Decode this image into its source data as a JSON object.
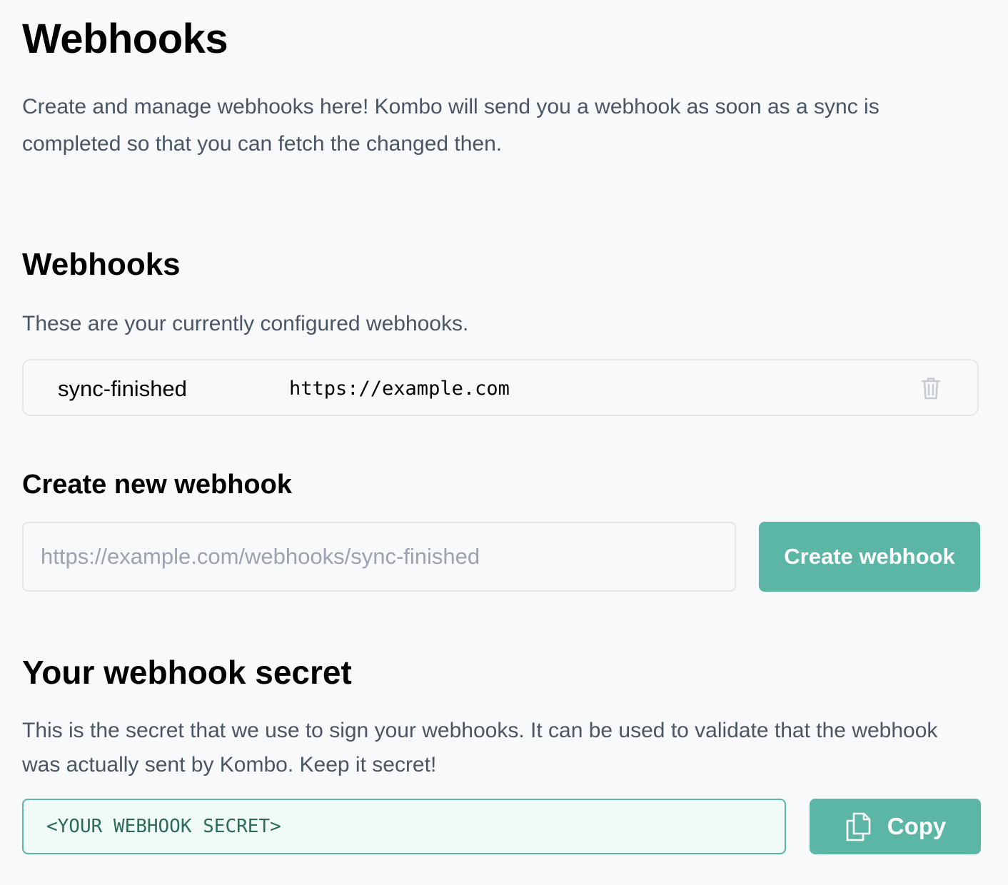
{
  "page": {
    "title": "Webhooks",
    "intro": "Create and manage webhooks here! Kombo will send you a webhook as soon as a sync is completed so that you can fetch the changed then."
  },
  "webhooks_section": {
    "title": "Webhooks",
    "description": "These are your currently configured webhooks.",
    "items": [
      {
        "event": "sync-finished",
        "url": "https://example.com",
        "delete_icon": "trash-icon"
      }
    ]
  },
  "create_section": {
    "title": "Create new webhook",
    "input_value": "",
    "input_placeholder": "https://example.com/webhooks/sync-finished",
    "button_label": "Create webhook"
  },
  "secret_section": {
    "title": "Your webhook secret",
    "description": "This is the secret that we use to sign your webhooks. It can be used to validate that the webhook was actually sent by Kombo. Keep it secret!",
    "secret_value": "<YOUR WEBHOOK SECRET>",
    "copy_label": "Copy",
    "copy_icon": "copy-icon"
  },
  "colors": {
    "accent": "#5bb6a5",
    "secret_background": "#f0fbf7",
    "secret_text": "#2b6b5c",
    "muted_text": "#4b5563",
    "placeholder_text": "#9ca3af",
    "border": "#e5e7eb",
    "page_background": "#f8f9fb"
  }
}
